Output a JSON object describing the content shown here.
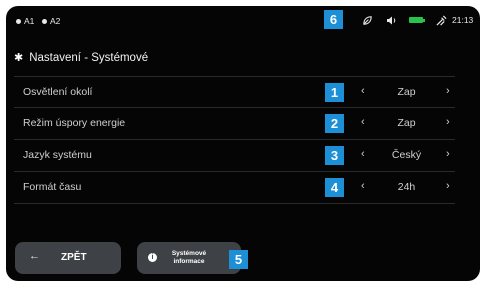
{
  "statusbar": {
    "sim1_label": "A1",
    "sim2_label": "A2",
    "time": "21:13",
    "icons": [
      "leaf-icon",
      "volume-icon",
      "battery-icon",
      "charging-plug-icon"
    ],
    "battery_color": "#29c24a"
  },
  "header": {
    "title": "Nastavení - Systémové",
    "icon": "gear-icon"
  },
  "settings": [
    {
      "label": "Osvětlení okolí",
      "value": "Zap",
      "marker": "1"
    },
    {
      "label": "Režim úspory energie",
      "value": "Zap",
      "marker": "2"
    },
    {
      "label": "Jazyk systému",
      "value": "Český",
      "marker": "3"
    },
    {
      "label": "Formát času",
      "value": "24h",
      "marker": "4"
    }
  ],
  "arrows": {
    "left": "‹",
    "right": "›"
  },
  "footer": {
    "back_arrow": "←",
    "back_label": "ZPĚT",
    "info_label_line1": "Systémové",
    "info_label_line2": "informace",
    "info_marker": "5"
  },
  "status_marker": "6",
  "accent_color": "#1d8fd6"
}
